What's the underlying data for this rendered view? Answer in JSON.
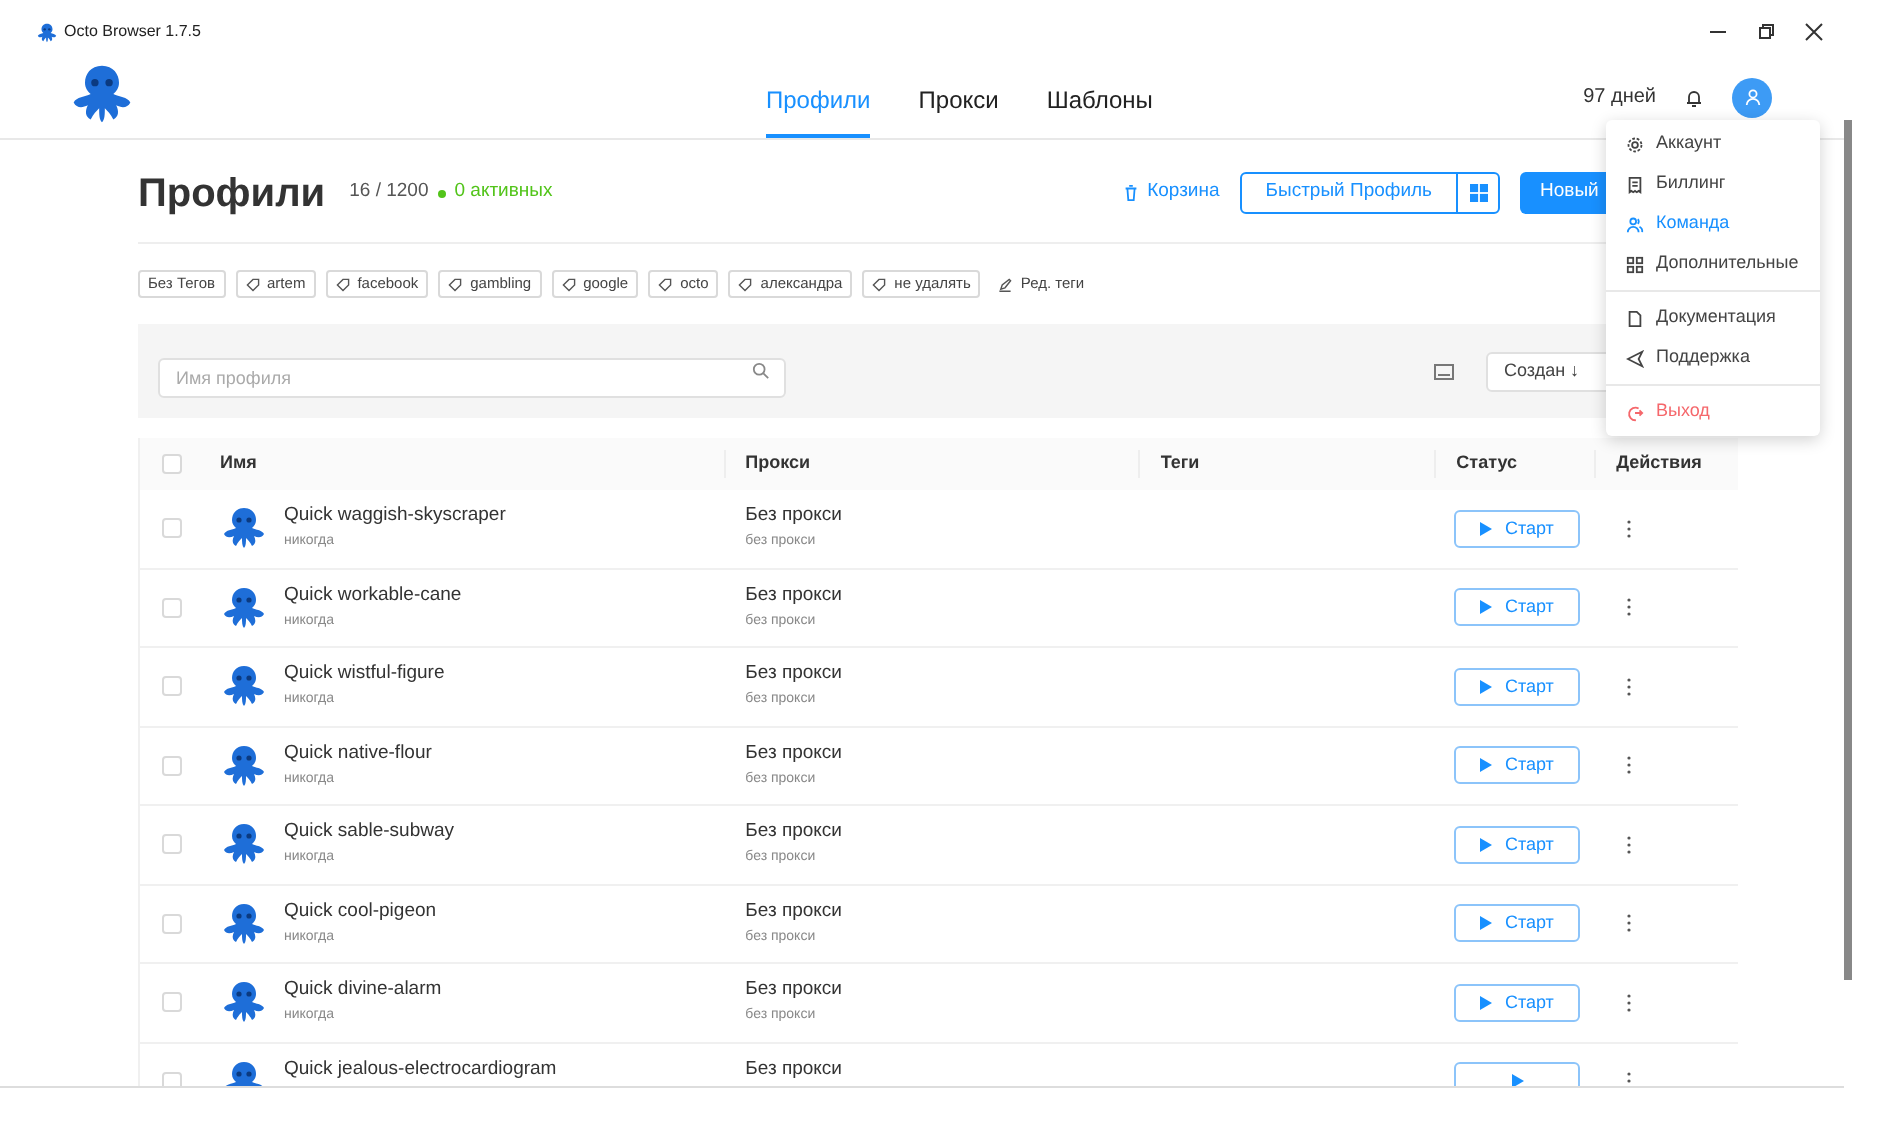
{
  "window": {
    "title": "Octo Browser 1.7.5"
  },
  "nav": [
    {
      "label": "Профили",
      "selected": true
    },
    {
      "label": "Прокси",
      "selected": false
    },
    {
      "label": "Шаблоны",
      "selected": false
    }
  ],
  "days_left": "97 дней",
  "page": {
    "title": "Профили",
    "count": "16 / 1200",
    "active": "0 активных"
  },
  "actions": {
    "trash": "Корзина",
    "quick_profile": "Быстрый Профиль",
    "new_profile": "Новый"
  },
  "tags": [
    {
      "label": "Без Тегов",
      "kind": "plain"
    },
    {
      "label": "artem",
      "kind": "tag"
    },
    {
      "label": "facebook",
      "kind": "tag"
    },
    {
      "label": "gambling",
      "kind": "tag"
    },
    {
      "label": "google",
      "kind": "tag"
    },
    {
      "label": "octo",
      "kind": "tag"
    },
    {
      "label": "александра",
      "kind": "tag"
    },
    {
      "label": "не удалять",
      "kind": "tag"
    }
  ],
  "edit_tags": "Ред. теги",
  "search": {
    "placeholder": "Имя профиля"
  },
  "sort": "Создан ↓",
  "table": {
    "select_all_checked": false,
    "columns": [
      "Имя",
      "Прокси",
      "Теги",
      "Статус",
      "Действия"
    ],
    "rows": [
      {
        "checked": false,
        "name": "Quick waggish-skyscraper",
        "last_seen": "никогда",
        "proxy": "Без прокси",
        "proxy_detail": "без прокси",
        "start": "Старт"
      },
      {
        "checked": false,
        "name": "Quick workable-cane",
        "last_seen": "никогда",
        "proxy": "Без прокси",
        "proxy_detail": "без прокси",
        "start": "Старт"
      },
      {
        "checked": false,
        "name": "Quick wistful-figure",
        "last_seen": "никогда",
        "proxy": "Без прокси",
        "proxy_detail": "без прокси",
        "start": "Старт"
      },
      {
        "checked": false,
        "name": "Quick native-flour",
        "last_seen": "никогда",
        "proxy": "Без прокси",
        "proxy_detail": "без прокси",
        "start": "Старт"
      },
      {
        "checked": false,
        "name": "Quick sable-subway",
        "last_seen": "никогда",
        "proxy": "Без прокси",
        "proxy_detail": "без прокси",
        "start": "Старт"
      },
      {
        "checked": false,
        "name": "Quick cool-pigeon",
        "last_seen": "никогда",
        "proxy": "Без прокси",
        "proxy_detail": "без прокси",
        "start": "Старт"
      },
      {
        "checked": false,
        "name": "Quick divine-alarm",
        "last_seen": "никогда",
        "proxy": "Без прокси",
        "proxy_detail": "без прокси",
        "start": "Старт"
      },
      {
        "checked": false,
        "name": "Quick jealous-electrocardiogram",
        "proxy": "Без прокси"
      }
    ]
  },
  "user_menu": {
    "groups": [
      [
        {
          "label": "Аккаунт",
          "kind": "gear",
          "selected": false
        },
        {
          "label": "Биллинг",
          "kind": "receipt",
          "selected": false
        },
        {
          "label": "Команда",
          "kind": "team",
          "selected": true
        },
        {
          "label": "Дополнительные",
          "kind": "grid",
          "selected": false
        }
      ],
      [
        {
          "label": "Документация",
          "kind": "doc",
          "selected": false
        },
        {
          "label": "Поддержка",
          "kind": "send",
          "selected": false
        }
      ],
      [
        {
          "label": "Выход",
          "kind": "logout",
          "selected": false
        }
      ]
    ]
  }
}
